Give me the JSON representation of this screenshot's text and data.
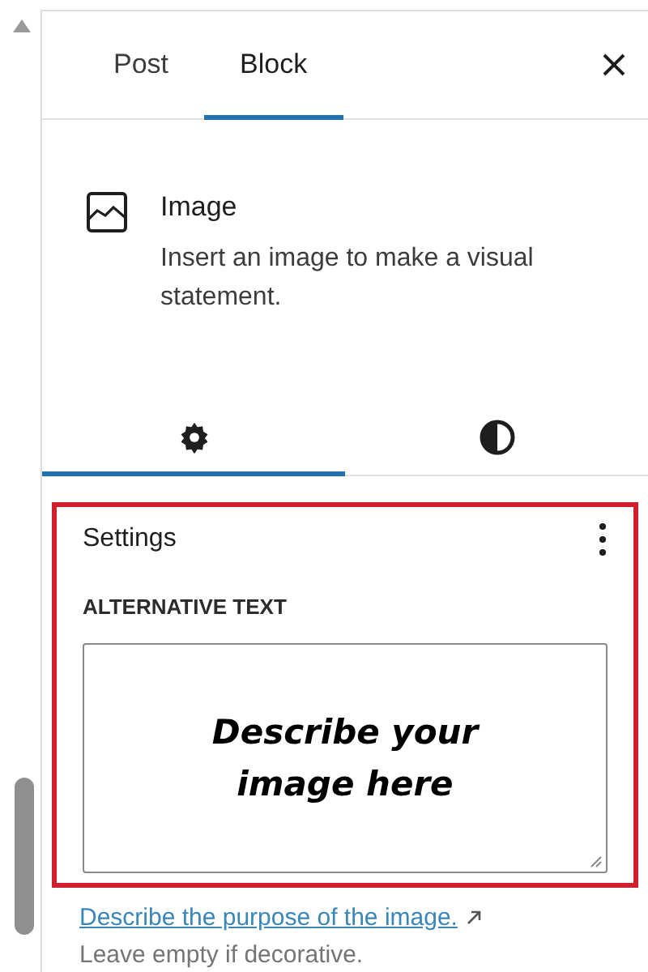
{
  "tabs": [
    {
      "label": "Post",
      "selected": false
    },
    {
      "label": "Block",
      "selected": true
    }
  ],
  "block": {
    "title": "Image",
    "description": "Insert an image to make a visual statement."
  },
  "panel_tabs": [
    {
      "kind": "settings",
      "selected": true
    },
    {
      "kind": "styles",
      "selected": false
    }
  ],
  "settings": {
    "title": "Settings",
    "highlighted": true,
    "field_label": "ALTERNATIVE TEXT",
    "annotation": "Describe your image here",
    "help_link": "Describe the purpose of the image.",
    "help_text": "Leave empty if decorative."
  }
}
